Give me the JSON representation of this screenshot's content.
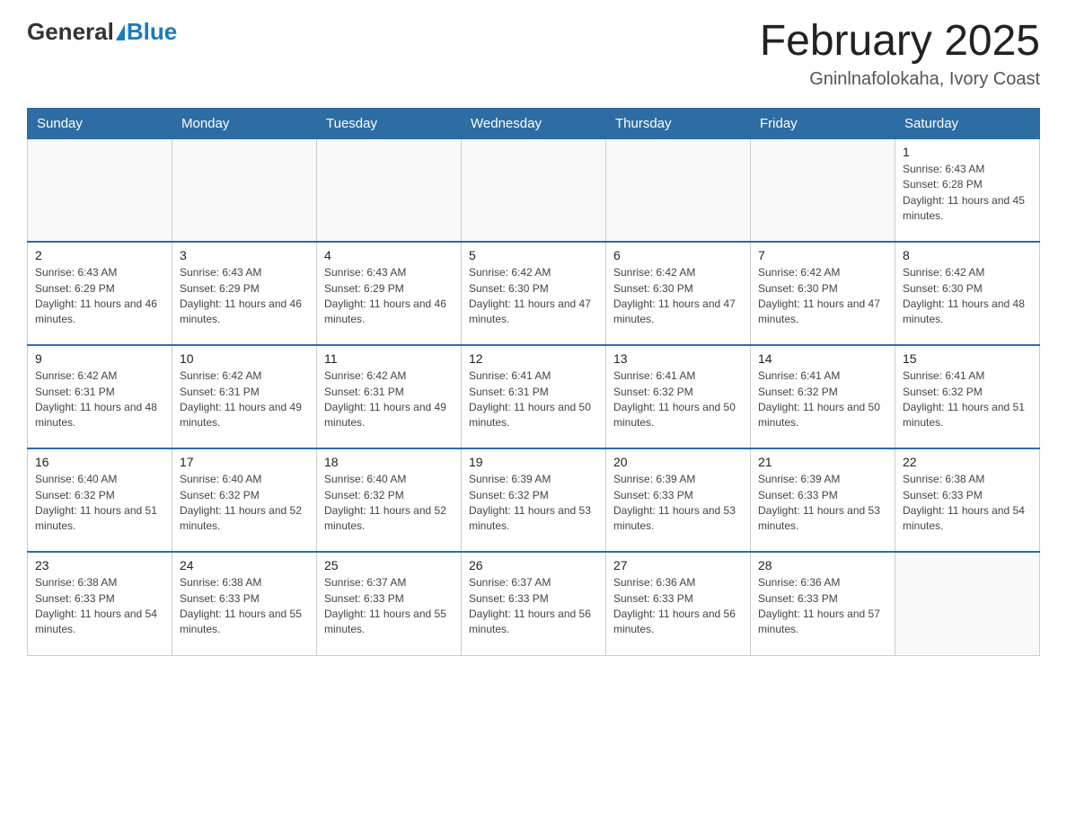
{
  "header": {
    "logo_general": "General",
    "logo_blue": "Blue",
    "month_year": "February 2025",
    "location": "Gninlnafolokaha, Ivory Coast"
  },
  "days_of_week": [
    "Sunday",
    "Monday",
    "Tuesday",
    "Wednesday",
    "Thursday",
    "Friday",
    "Saturday"
  ],
  "weeks": [
    [
      {
        "day": "",
        "info": ""
      },
      {
        "day": "",
        "info": ""
      },
      {
        "day": "",
        "info": ""
      },
      {
        "day": "",
        "info": ""
      },
      {
        "day": "",
        "info": ""
      },
      {
        "day": "",
        "info": ""
      },
      {
        "day": "1",
        "info": "Sunrise: 6:43 AM\nSunset: 6:28 PM\nDaylight: 11 hours and 45 minutes."
      }
    ],
    [
      {
        "day": "2",
        "info": "Sunrise: 6:43 AM\nSunset: 6:29 PM\nDaylight: 11 hours and 46 minutes."
      },
      {
        "day": "3",
        "info": "Sunrise: 6:43 AM\nSunset: 6:29 PM\nDaylight: 11 hours and 46 minutes."
      },
      {
        "day": "4",
        "info": "Sunrise: 6:43 AM\nSunset: 6:29 PM\nDaylight: 11 hours and 46 minutes."
      },
      {
        "day": "5",
        "info": "Sunrise: 6:42 AM\nSunset: 6:30 PM\nDaylight: 11 hours and 47 minutes."
      },
      {
        "day": "6",
        "info": "Sunrise: 6:42 AM\nSunset: 6:30 PM\nDaylight: 11 hours and 47 minutes."
      },
      {
        "day": "7",
        "info": "Sunrise: 6:42 AM\nSunset: 6:30 PM\nDaylight: 11 hours and 47 minutes."
      },
      {
        "day": "8",
        "info": "Sunrise: 6:42 AM\nSunset: 6:30 PM\nDaylight: 11 hours and 48 minutes."
      }
    ],
    [
      {
        "day": "9",
        "info": "Sunrise: 6:42 AM\nSunset: 6:31 PM\nDaylight: 11 hours and 48 minutes."
      },
      {
        "day": "10",
        "info": "Sunrise: 6:42 AM\nSunset: 6:31 PM\nDaylight: 11 hours and 49 minutes."
      },
      {
        "day": "11",
        "info": "Sunrise: 6:42 AM\nSunset: 6:31 PM\nDaylight: 11 hours and 49 minutes."
      },
      {
        "day": "12",
        "info": "Sunrise: 6:41 AM\nSunset: 6:31 PM\nDaylight: 11 hours and 50 minutes."
      },
      {
        "day": "13",
        "info": "Sunrise: 6:41 AM\nSunset: 6:32 PM\nDaylight: 11 hours and 50 minutes."
      },
      {
        "day": "14",
        "info": "Sunrise: 6:41 AM\nSunset: 6:32 PM\nDaylight: 11 hours and 50 minutes."
      },
      {
        "day": "15",
        "info": "Sunrise: 6:41 AM\nSunset: 6:32 PM\nDaylight: 11 hours and 51 minutes."
      }
    ],
    [
      {
        "day": "16",
        "info": "Sunrise: 6:40 AM\nSunset: 6:32 PM\nDaylight: 11 hours and 51 minutes."
      },
      {
        "day": "17",
        "info": "Sunrise: 6:40 AM\nSunset: 6:32 PM\nDaylight: 11 hours and 52 minutes."
      },
      {
        "day": "18",
        "info": "Sunrise: 6:40 AM\nSunset: 6:32 PM\nDaylight: 11 hours and 52 minutes."
      },
      {
        "day": "19",
        "info": "Sunrise: 6:39 AM\nSunset: 6:32 PM\nDaylight: 11 hours and 53 minutes."
      },
      {
        "day": "20",
        "info": "Sunrise: 6:39 AM\nSunset: 6:33 PM\nDaylight: 11 hours and 53 minutes."
      },
      {
        "day": "21",
        "info": "Sunrise: 6:39 AM\nSunset: 6:33 PM\nDaylight: 11 hours and 53 minutes."
      },
      {
        "day": "22",
        "info": "Sunrise: 6:38 AM\nSunset: 6:33 PM\nDaylight: 11 hours and 54 minutes."
      }
    ],
    [
      {
        "day": "23",
        "info": "Sunrise: 6:38 AM\nSunset: 6:33 PM\nDaylight: 11 hours and 54 minutes."
      },
      {
        "day": "24",
        "info": "Sunrise: 6:38 AM\nSunset: 6:33 PM\nDaylight: 11 hours and 55 minutes."
      },
      {
        "day": "25",
        "info": "Sunrise: 6:37 AM\nSunset: 6:33 PM\nDaylight: 11 hours and 55 minutes."
      },
      {
        "day": "26",
        "info": "Sunrise: 6:37 AM\nSunset: 6:33 PM\nDaylight: 11 hours and 56 minutes."
      },
      {
        "day": "27",
        "info": "Sunrise: 6:36 AM\nSunset: 6:33 PM\nDaylight: 11 hours and 56 minutes."
      },
      {
        "day": "28",
        "info": "Sunrise: 6:36 AM\nSunset: 6:33 PM\nDaylight: 11 hours and 57 minutes."
      },
      {
        "day": "",
        "info": ""
      }
    ]
  ]
}
